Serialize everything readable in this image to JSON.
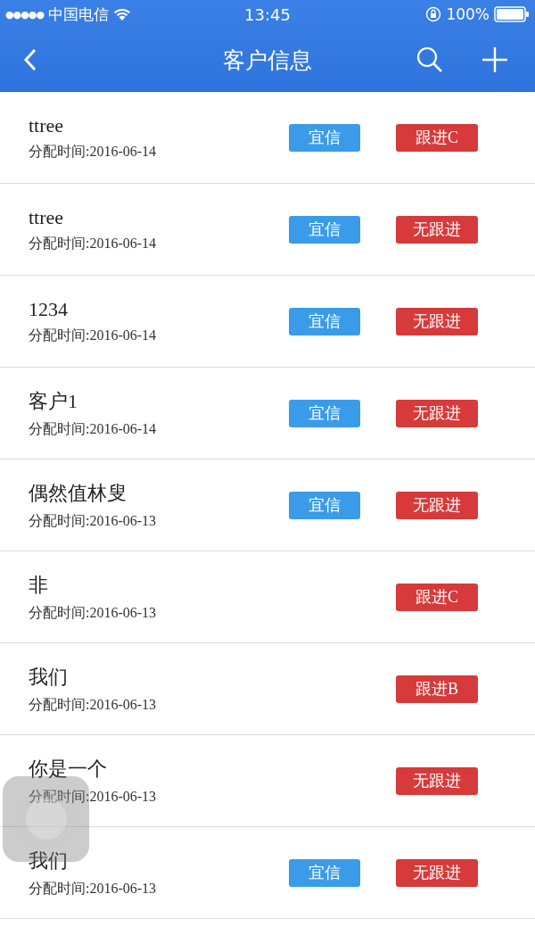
{
  "status_bar": {
    "signal": "●●●●●",
    "carrier": "中国电信",
    "time": "13:45",
    "battery": "100%"
  },
  "nav": {
    "title": "客户信息"
  },
  "rows": [
    {
      "name": "ttree",
      "date": "分配时间:2016-06-14",
      "tags": [
        {
          "kind": "channel",
          "label": "宜信"
        },
        {
          "kind": "status",
          "label": "跟进C"
        }
      ]
    },
    {
      "name": "ttree",
      "date": "分配时间:2016-06-14",
      "tags": [
        {
          "kind": "channel",
          "label": "宜信"
        },
        {
          "kind": "status",
          "label": "无跟进"
        }
      ]
    },
    {
      "name": "1234",
      "date": "分配时间:2016-06-14",
      "tags": [
        {
          "kind": "channel",
          "label": "宜信"
        },
        {
          "kind": "status",
          "label": "无跟进"
        }
      ]
    },
    {
      "name": "客户1",
      "date": "分配时间:2016-06-14",
      "tags": [
        {
          "kind": "channel",
          "label": "宜信"
        },
        {
          "kind": "status",
          "label": "无跟进"
        }
      ]
    },
    {
      "name": "偶然值林叟",
      "date": "分配时间:2016-06-13",
      "tags": [
        {
          "kind": "channel",
          "label": "宜信"
        },
        {
          "kind": "status",
          "label": "无跟进"
        }
      ]
    },
    {
      "name": "非",
      "date": "分配时间:2016-06-13",
      "tags": [
        {
          "kind": "status",
          "label": "跟进C"
        }
      ]
    },
    {
      "name": "我们",
      "date": "分配时间:2016-06-13",
      "tags": [
        {
          "kind": "status",
          "label": "跟进B"
        }
      ]
    },
    {
      "name": "你是一个",
      "date": "分配时间:2016-06-13",
      "tags": [
        {
          "kind": "status",
          "label": "无跟进"
        }
      ]
    },
    {
      "name": "我们",
      "date": "分配时间:2016-06-13",
      "tags": [
        {
          "kind": "channel",
          "label": "宜信"
        },
        {
          "kind": "status",
          "label": "无跟进"
        }
      ]
    }
  ]
}
